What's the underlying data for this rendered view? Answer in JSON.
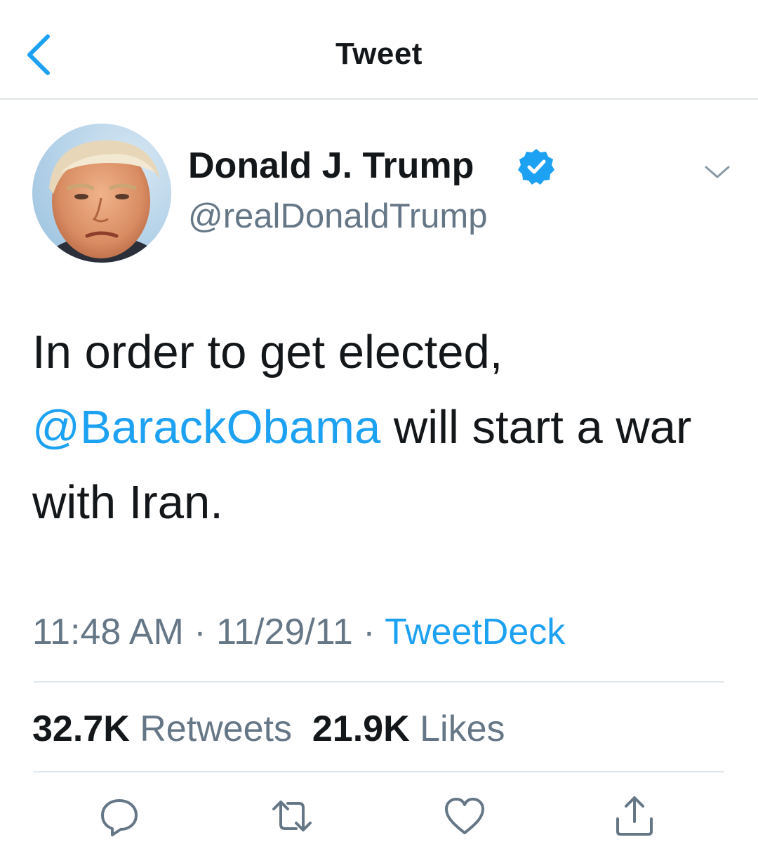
{
  "header": {
    "title": "Tweet"
  },
  "author": {
    "display_name": "Donald J. Trump",
    "handle": "@realDonaldTrump",
    "verified": true
  },
  "tweet": {
    "text_part1": "In order to get elected,",
    "mention": "@BarackObama",
    "text_part2": " will start a war with Iran."
  },
  "meta": {
    "time": "11:48 AM",
    "separator": " · ",
    "date": "11/29/11",
    "source": "TweetDeck"
  },
  "stats": {
    "retweets_count": "32.7K",
    "retweets_label": "Retweets",
    "likes_count": "21.9K",
    "likes_label": "Likes"
  },
  "icons": {
    "back": "chevron-left-icon",
    "verified": "verified-badge-icon",
    "more": "chevron-down-icon",
    "reply": "reply-icon",
    "retweet": "retweet-icon",
    "like": "heart-icon",
    "share": "share-icon"
  },
  "colors": {
    "accent": "#1da1f2",
    "secondary_text": "#657786",
    "primary_text": "#14171a",
    "divider": "#e1e8ed"
  }
}
